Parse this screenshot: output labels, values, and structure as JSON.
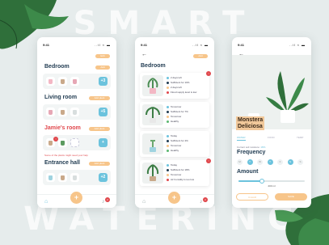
{
  "headline": {
    "top": "SMART",
    "bottom": "WATERING"
  },
  "colors": {
    "accent": "#f7c58a",
    "blue": "#6cc3dd",
    "red": "#e0474c",
    "navy": "#1f3a50"
  },
  "status": {
    "time": "9:41",
    "signal": "..il ≈ ▬"
  },
  "screen1": {
    "edit_pill": "Edit",
    "rooms": [
      {
        "title": "Bedroom",
        "pill": "Add",
        "count": "+3",
        "pots": [
          "pink-pot",
          "tan-pot",
          "rose-pot"
        ]
      },
      {
        "title": "Living room",
        "pill": "Add plant",
        "count": "+5",
        "pots": [
          "rose-pot",
          "tan-pot",
          "white-pot"
        ]
      },
      {
        "title": "Jamie's room",
        "pill": "Add plant",
        "count": "+",
        "pots": [
          "tan-pot",
          "plant"
        ]
      },
      {
        "title": "Entrance hall",
        "pill": "Add plant",
        "count": "+2",
        "pots": [
          "blue-pot",
          "tan-pot",
          "white-pot"
        ]
      }
    ],
    "warning": "Some of the plants might need your help",
    "nav_badge": "2"
  },
  "screen2": {
    "back_icon": "back-arrow-icon",
    "pill": "Add",
    "title": "Bedroom",
    "cards": [
      {
        "lines": [
          "2 days left",
          "Sufficient for 10%",
          "2 days left",
          "Flood supply level is low"
        ],
        "badge": "!"
      },
      {
        "lines": [
          "Tomorrow",
          "Sufficient for 7%",
          "Tomorrow",
          "Healthy"
        ]
      },
      {
        "lines": [
          "Today",
          "Sufficient for 4%",
          "Tomorrow",
          "Healthy"
        ]
      },
      {
        "lines": [
          "Today",
          "Sufficient for 18%",
          "Tomorrow",
          "Air humidity is too low"
        ],
        "badge": "!"
      }
    ],
    "nav_badge": "2"
  },
  "screen3": {
    "back_icon": "back-arrow-icon",
    "plant_name": [
      "Monstera",
      "Deliciosa"
    ],
    "tabs": [
      "WATER",
      "FOOD",
      "TEMP"
    ],
    "moisture_label": "Current soil moisture:",
    "moisture_value": "18%",
    "frequency_title": "Frequency",
    "days": [
      {
        "label": "M",
        "on": false
      },
      {
        "label": "T",
        "on": true
      },
      {
        "label": "W",
        "on": false
      },
      {
        "label": "T",
        "on": true
      },
      {
        "label": "F",
        "on": false
      },
      {
        "label": "S",
        "on": true
      },
      {
        "label": "S",
        "on": false
      }
    ],
    "amount_title": "Amount",
    "amount_value": "200 ml",
    "amount_fraction": 0.35,
    "buttons": {
      "cancel": "CLEAR",
      "save": "SAVE"
    }
  }
}
